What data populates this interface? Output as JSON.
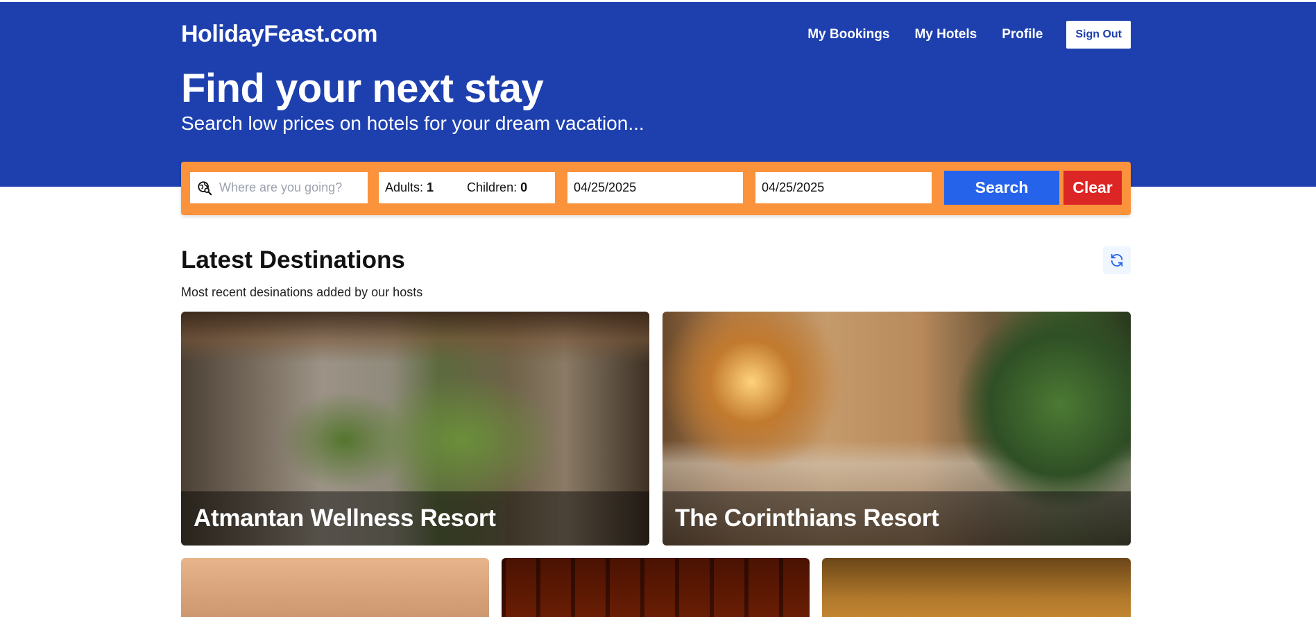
{
  "header": {
    "logo": "HolidayFeast.com",
    "nav": {
      "my_bookings": "My Bookings",
      "my_hotels": "My Hotels",
      "profile": "Profile",
      "sign_out": "Sign Out"
    },
    "title": "Find your next stay",
    "subtitle": "Search low prices on hotels for your dream vacation..."
  },
  "search": {
    "destination_placeholder": "Where are you going?",
    "destination_value": "",
    "adults_label": "Adults:",
    "adults_value": "1",
    "children_label": "Children:",
    "children_value": "0",
    "check_in": "04/25/2025",
    "check_out": "04/25/2025",
    "search_label": "Search",
    "clear_label": "Clear"
  },
  "latest": {
    "title": "Latest Destinations",
    "subtitle": "Most recent desinations added by our hosts",
    "cards": [
      {
        "name": "Atmantan Wellness Resort"
      },
      {
        "name": "The Corinthians Resort"
      }
    ]
  },
  "colors": {
    "header_bg": "#1e40af",
    "search_bar": "#fb923c",
    "search_button": "#2563eb",
    "clear_button": "#dc2626"
  },
  "icons": {
    "destination": "globe-search-icon",
    "refresh": "refresh-icon"
  }
}
